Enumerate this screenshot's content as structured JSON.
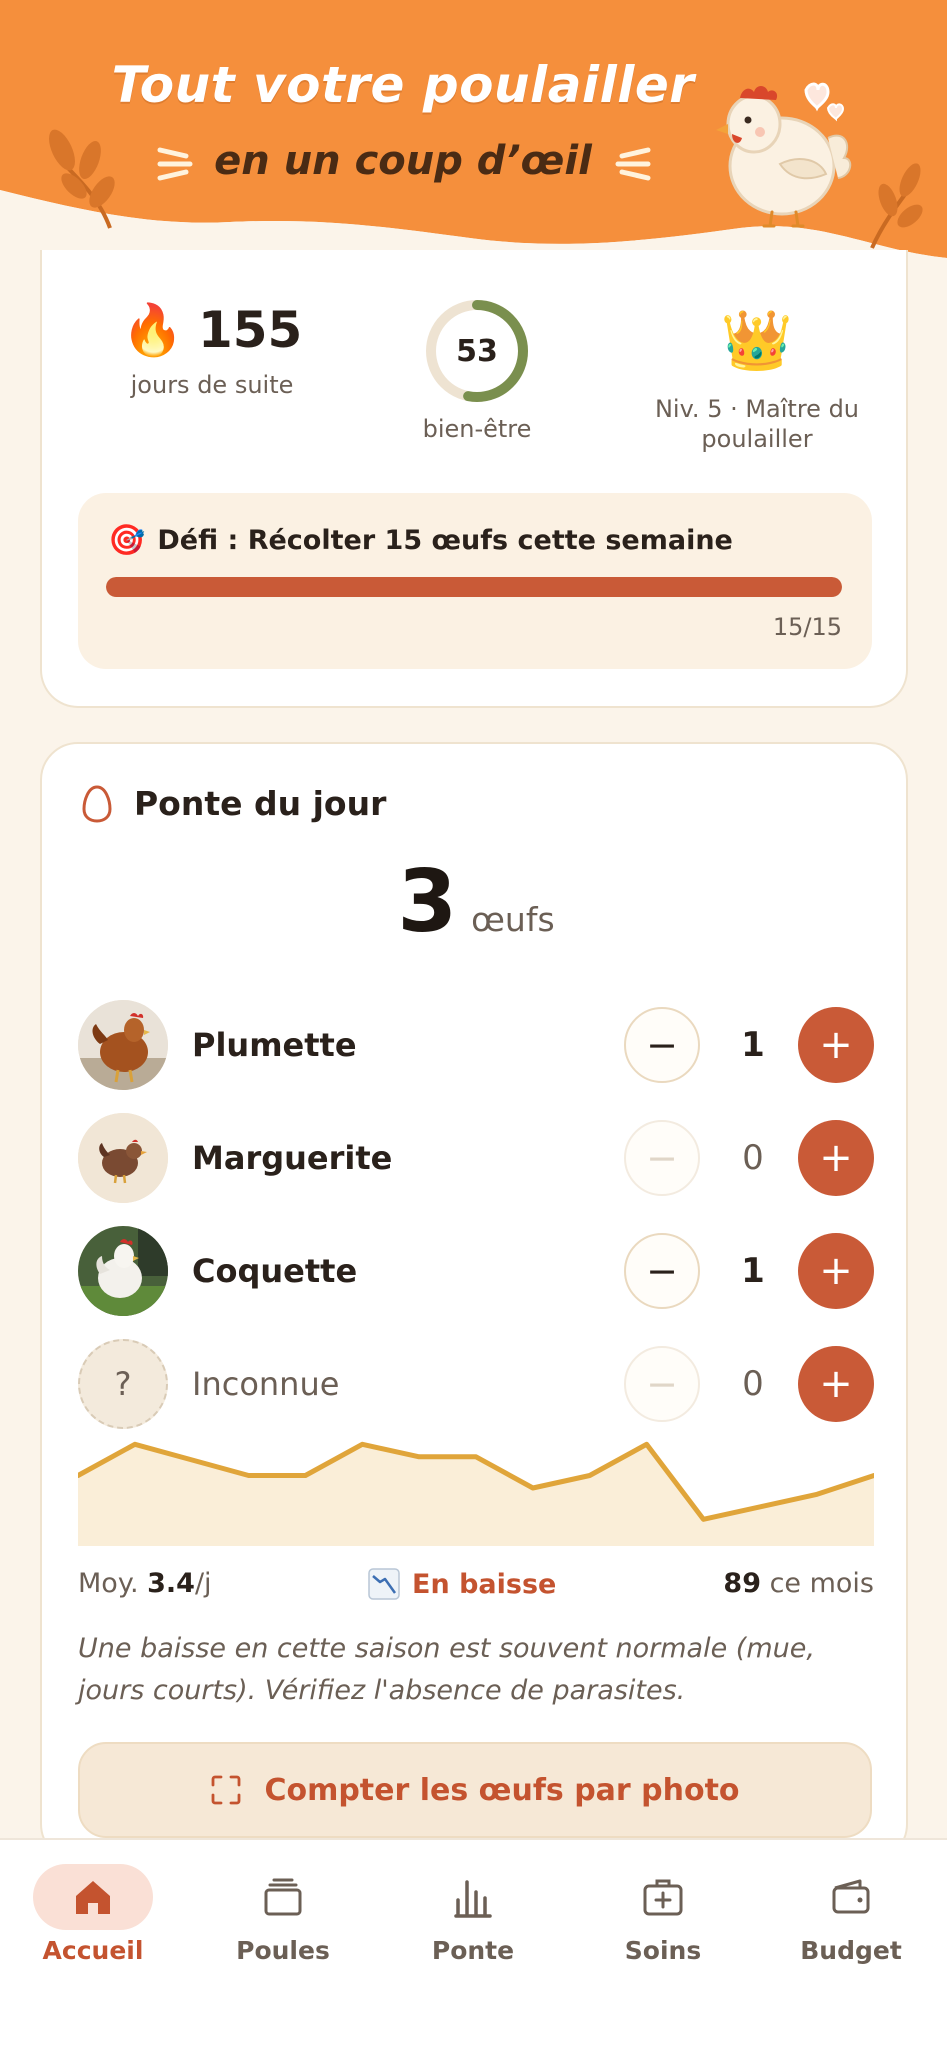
{
  "banner": {
    "title": "Tout votre poulailler",
    "subtitle": "en un coup d’œil"
  },
  "stats": {
    "streak": {
      "value": "155",
      "label": "jours de suite",
      "icon": "fire-icon"
    },
    "wellbeing": {
      "value": "53",
      "label": "bien-être",
      "percent": 53
    },
    "level": {
      "label": "Niv. 5 · Maître du poulailler",
      "icon": "crown-icon"
    }
  },
  "challenge": {
    "title": "Défi : Récolter 15 œufs cette semaine",
    "progress": "15/15",
    "fraction": 1.0,
    "icon": "target-icon"
  },
  "ponte": {
    "title": "Ponte du jour",
    "total": "3",
    "unit": "œufs",
    "hens": [
      {
        "name": "Plumette",
        "count": "1",
        "avatar": "brown-hen-photo"
      },
      {
        "name": "Marguerite",
        "count": "0",
        "avatar": "hen-illustration"
      },
      {
        "name": "Coquette",
        "count": "1",
        "avatar": "white-hen-photo"
      },
      {
        "name": "Inconnue",
        "count": "0",
        "avatar": "unknown-placeholder",
        "avatar_glyph": "?"
      }
    ],
    "trend_values": [
      4,
      5,
      4.5,
      4,
      4,
      5,
      4.6,
      4.6,
      3.6,
      4,
      5,
      2.6,
      3,
      3.4,
      4
    ],
    "avg_label": "Moy. ",
    "avg_value": "3.4",
    "avg_unit": "/j",
    "trend_label": "En baisse",
    "month_value": "89",
    "month_label": " ce mois",
    "advice": "Une baisse en cette saison est souvent normale (mue, jours courts). Vérifiez l'absence de parasites.",
    "photo_button": "Compter les œufs par photo"
  },
  "nav": {
    "items": [
      {
        "label": "Accueil",
        "icon": "home-icon",
        "active": true
      },
      {
        "label": "Poules",
        "icon": "cards-icon",
        "active": false
      },
      {
        "label": "Ponte",
        "icon": "bar-chart-icon",
        "active": false
      },
      {
        "label": "Soins",
        "icon": "medical-kit-icon",
        "active": false
      },
      {
        "label": "Budget",
        "icon": "wallet-icon",
        "active": false
      }
    ]
  },
  "colors": {
    "accent": "#c95a37",
    "banner": "#f58f3c",
    "background": "#fbf4ea",
    "chart_line": "#e0a53a",
    "chart_fill": "#faeed8",
    "ring": "#7a8f4e"
  }
}
